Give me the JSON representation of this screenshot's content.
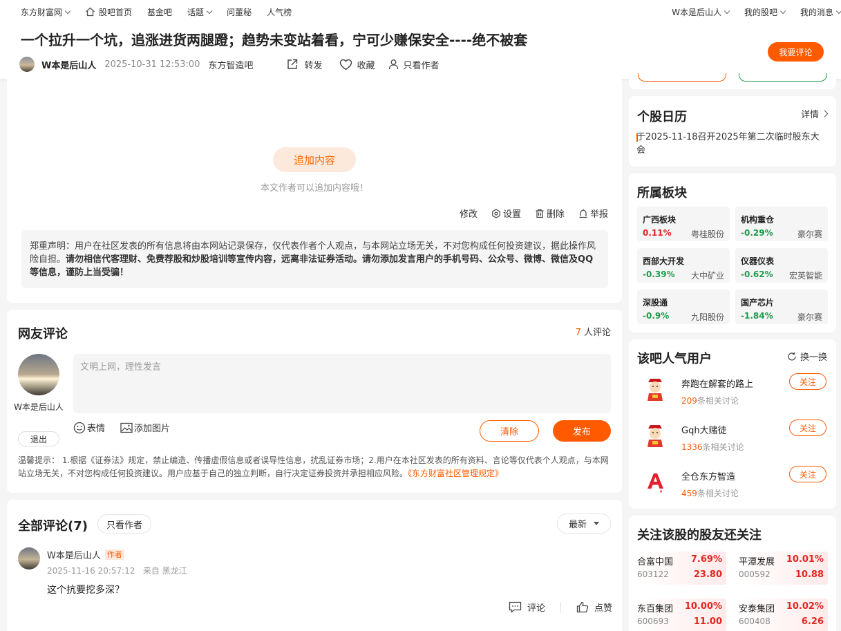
{
  "topnav": {
    "left": [
      "东方财富网",
      "股吧首页",
      "基金吧",
      "话题",
      "问董秘",
      "人气榜"
    ],
    "right": [
      "W本是后山人",
      "我的股吧",
      "我的消息"
    ]
  },
  "post": {
    "title": "一个拉升一个坑，追涨进货两腿蹬；趋势未变站着看，宁可少赚保安全----绝不被套",
    "author": "W本是后山人",
    "date": "2025-10-31 12:53:00",
    "bar": "东方智造吧",
    "actions": [
      "转发",
      "收藏",
      "只看作者"
    ],
    "comment_button": "我要评论",
    "add_content": "追加内容",
    "add_hint": "本文作者可以追加内容哦！",
    "ops": [
      "修改",
      "设置",
      "删除",
      "举报"
    ],
    "notice_normal": "郑重声明：用户在社区发表的所有信息将由本网站记录保存，仅代表作者个人观点，与本网站立场无关，不对您构成任何投资建议，据此操作风险自担。",
    "notice_bold": "请勿相信代客理财、免费荐股和炒股培训等宣传内容，远离非法证券活动。请勿添加发言用户的手机号码、公众号、微博、微信及QQ等信息，谨防上当受骗！"
  },
  "comment_box": {
    "title": "网友评论",
    "count": "7",
    "count_suffix": "人评论",
    "user": "W本是后山人",
    "logout": "退出",
    "placeholder": "文明上网，理性发言",
    "emoji": "表情",
    "image": "添加图片",
    "clear": "清除",
    "publish": "发布",
    "tips": "温馨提示： 1.根据《证券法》规定，禁止编造、传播虚假信息或者误导性信息，扰乱证券市场；2.用户在本社区发表的所有资料、言论等仅代表个人观点，与本网站立场无关，不对您构成任何投资建议。用户应基于自己的独立判断，自行决定证券投资并承担相应风险。",
    "tips_link": "《东方财富社区管理规定》"
  },
  "all_comments": {
    "title": "全部评论(7)",
    "only_author": "只看作者",
    "sort": "最新",
    "items": [
      {
        "name": "W本是后山人",
        "tag": "作者",
        "time": "2025-11-16 20:57:12",
        "from": "来自 黑龙江",
        "text": "这个抗要挖多深？",
        "reply": "评论",
        "like": "点赞"
      }
    ]
  },
  "calendar": {
    "title": "个股日历",
    "more": "详情",
    "item": "于2025-11-18召开2025年第二次临时股东大会"
  },
  "sectors": {
    "title": "所属板块",
    "items": [
      {
        "name": "广西板块",
        "pct": "0.11%",
        "stock": "粤桂股份",
        "dir": "up"
      },
      {
        "name": "机构重仓",
        "pct": "-0.29%",
        "stock": "豪尔赛",
        "dir": "down"
      },
      {
        "name": "西部大开发",
        "pct": "-0.39%",
        "stock": "大中矿业",
        "dir": "down"
      },
      {
        "name": "仪器仪表",
        "pct": "-0.62%",
        "stock": "宏英智能",
        "dir": "down"
      },
      {
        "name": "深股通",
        "pct": "-0.9%",
        "stock": "九阳股份",
        "dir": "down"
      },
      {
        "name": "国产芯片",
        "pct": "-1.84%",
        "stock": "豪尔赛",
        "dir": "down"
      }
    ]
  },
  "popular_users": {
    "title": "该吧人气用户",
    "refresh": "换一换",
    "follow": "关注",
    "count_suffix": "条相关讨论",
    "items": [
      {
        "name": "奔跑在解套的路上",
        "count": "209"
      },
      {
        "name": "Gqh大赌徒",
        "count": "1336"
      },
      {
        "name": "全仓东方智造",
        "count": "459"
      }
    ]
  },
  "also_follow": {
    "title": "关注该股的股友还关注",
    "items": [
      {
        "name": "合富中国",
        "pct": "7.69%",
        "code": "603122",
        "price": "23.80"
      },
      {
        "name": "平潭发展",
        "pct": "10.01%",
        "code": "000592",
        "price": "10.88"
      },
      {
        "name": "东百集团",
        "pct": "10.00%",
        "code": "600693",
        "price": "11.00"
      },
      {
        "name": "安泰集团",
        "pct": "10.02%",
        "code": "600408",
        "price": "6.26"
      }
    ]
  },
  "colors": {
    "accent": "#ff5a00",
    "up": "#e4251f",
    "down": "#1d9c4a"
  }
}
